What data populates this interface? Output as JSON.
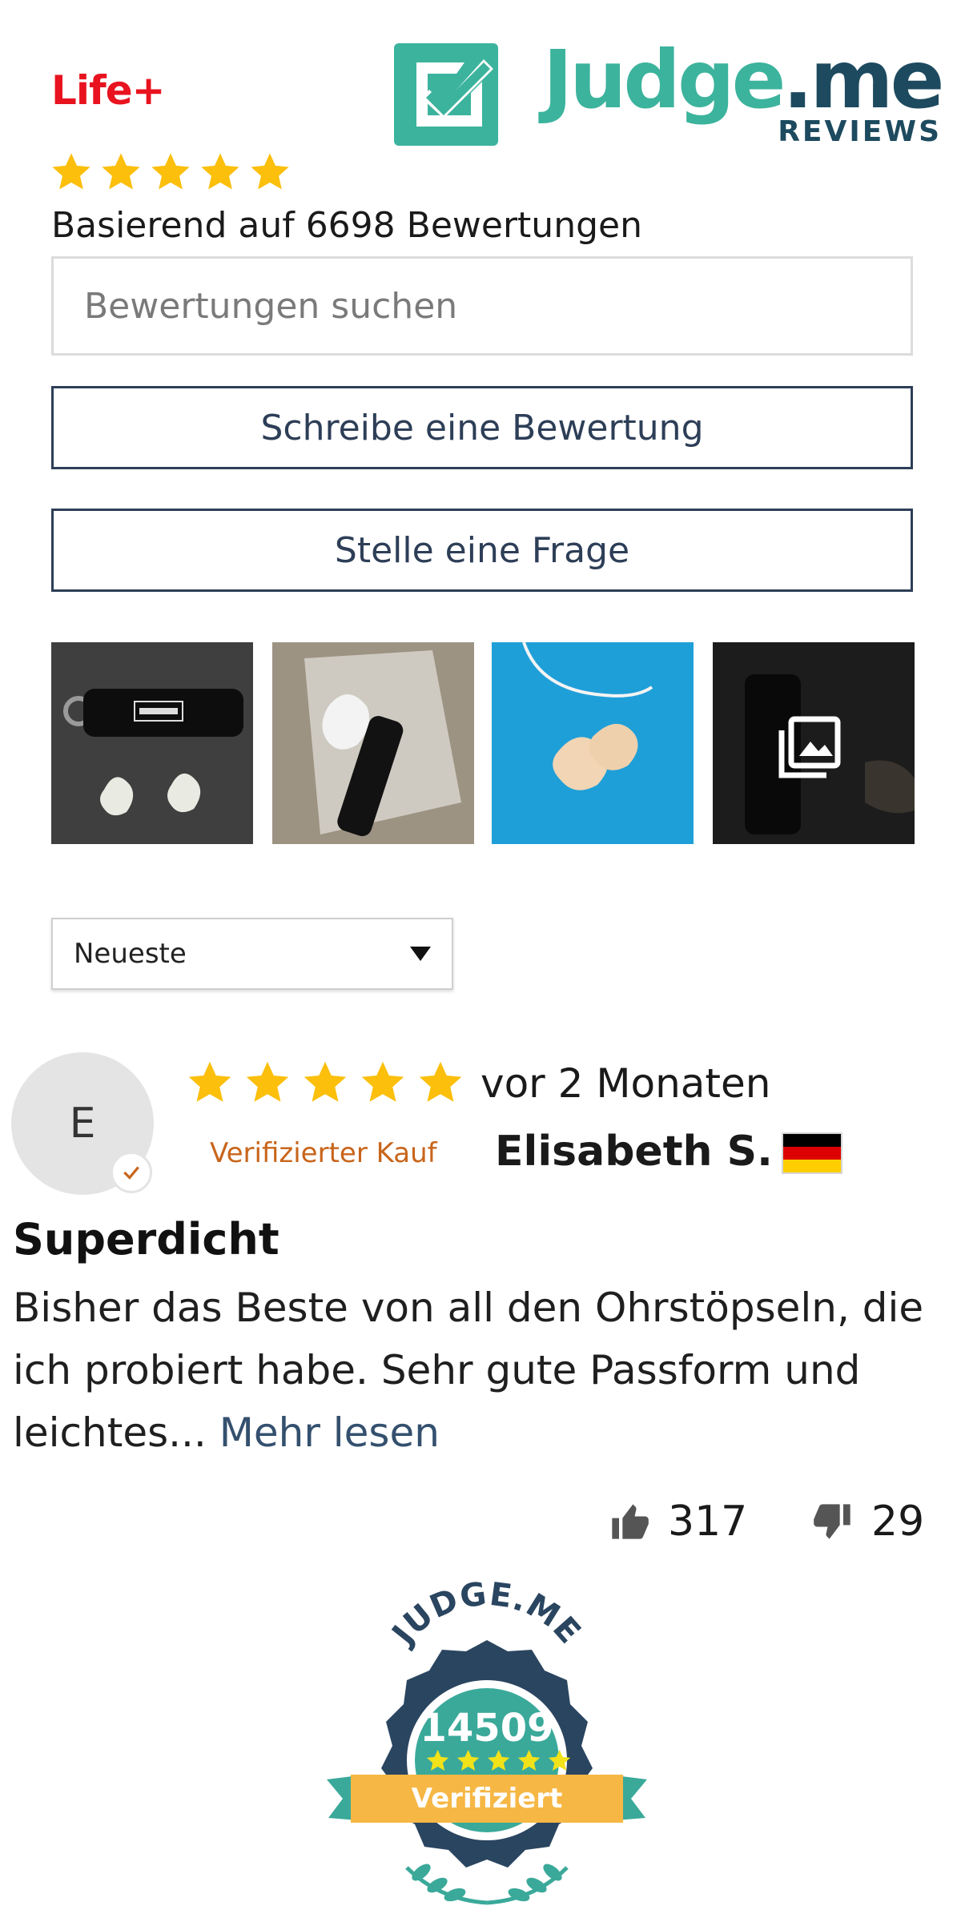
{
  "brand": {
    "name": "Life+",
    "color": "#e8131f"
  },
  "judgeme_logo": {
    "word": "Judge",
    "suffix": ".me",
    "sub": "REVIEWS",
    "colors": {
      "teal": "#3cb39d",
      "navy": "#1d4a5f"
    }
  },
  "summary": {
    "rating_stars": 5,
    "text": "Basierend auf 6698 Bewertungen"
  },
  "search": {
    "placeholder": "Bewertungen suchen",
    "value": ""
  },
  "actions": {
    "write_review": "Schreibe eine Bewertung",
    "ask_question": "Stelle eine Frage"
  },
  "media_gallery": [
    {
      "icon": "earplug-case-photo"
    },
    {
      "icon": "earplug-package-photo"
    },
    {
      "icon": "earplug-blue-background-photo"
    },
    {
      "icon": "gallery-more-icon"
    }
  ],
  "sort": {
    "selected": "Neueste"
  },
  "review": {
    "avatar_initial": "E",
    "rating_stars": 5,
    "time_ago": "vor 2 Monaten",
    "verified_label": "Verifizierter Kauf",
    "author": "Elisabeth S.",
    "country_flag": "germany-flag-icon",
    "title": "Superdicht",
    "body": "Bisher das Beste von all den Ohrstöpseln, die ich probiert habe. Sehr gute Passform und leichtes...",
    "read_more": "Mehr lesen",
    "votes_up": "317",
    "votes_down": "29"
  },
  "badge": {
    "arc_text": "JUDGE.ME",
    "count": "14509",
    "stars": 5,
    "ribbon": "Verifiziert",
    "colors": {
      "navy": "#2a4560",
      "teal": "#3aa99a",
      "gold": "#f6b744",
      "star": "#f2e21a"
    }
  }
}
